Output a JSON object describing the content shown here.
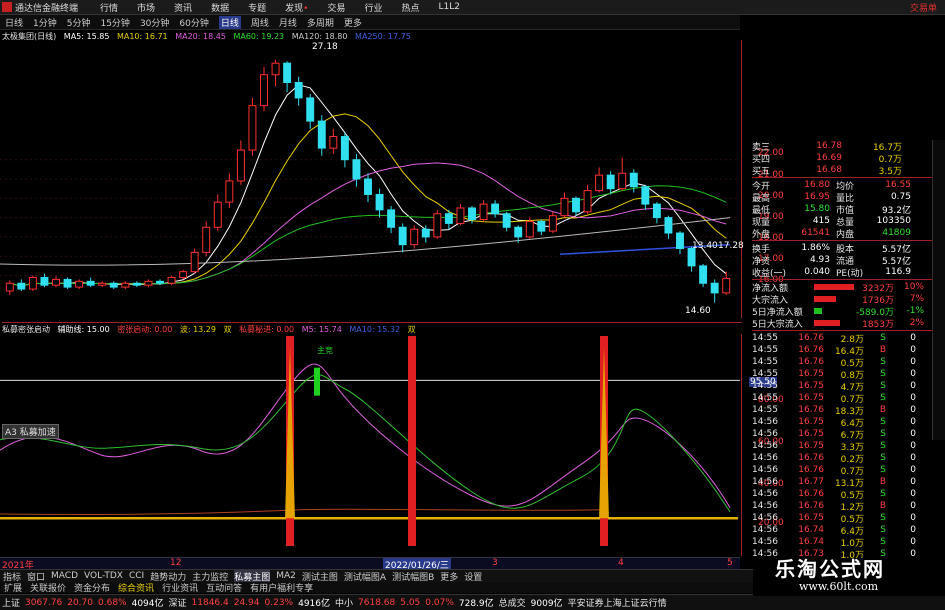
{
  "app": {
    "title": "通达信金融终端",
    "menu": [
      "行情",
      "市场",
      "资讯",
      "数据",
      "专题",
      "发现",
      "交易",
      "行业",
      "热点",
      "L1L2"
    ],
    "top_right": "交易单"
  },
  "periods": [
    "日线",
    "1分钟",
    "5分钟",
    "15分钟",
    "30分钟",
    "60分钟",
    "日线",
    "周线",
    "月线",
    "多周期",
    "更多"
  ],
  "main_legend": {
    "name": "太极集团(日线)",
    "ma5": "MA5: 15.85",
    "ma10": "MA10: 16.71",
    "ma20": "MA20: 18.45",
    "ma60": "MA60: 19.23",
    "ma120": "MA120: 18.80",
    "ma250": "MA250: 17.75"
  },
  "annotations": {
    "high": "27.18",
    "low": "14.60",
    "mid": "13.40",
    "right_mark": "17.28"
  },
  "price_axis": [
    "22.00",
    "21.00",
    "20.00",
    "19.00",
    "18.00",
    "17.00",
    "16.00",
    "15.00"
  ],
  "ind_legend": {
    "name": "私募密张启动",
    "a": "辅助线: 15.00",
    "b": "密张启动: 0.00",
    "c": "波: 13.29",
    "d": "私募秘进: 0.00",
    "e": "M5: 15.74",
    "f": "MA10: 15.32"
  },
  "ind_axis": [
    "95.50",
    "80.00",
    "60.00",
    "40.00",
    "20.00"
  ],
  "markers": {
    "m1": "双",
    "m2": "双",
    "green": "主竞"
  },
  "overlay_label": "A3 私募加速",
  "time_axis": {
    "left": "2021年",
    "mid1": "12",
    "cursor": "2022/01/26/三",
    "mid2": "3",
    "mid3": "4",
    "mid4": "5"
  },
  "quote": {
    "sell": [
      [
        "卖三",
        "16.78",
        "16.7万"
      ],
      [
        "买四",
        "16.69",
        "0.7万"
      ],
      [
        "买五",
        "16.68",
        "3.5万"
      ]
    ],
    "stats": [
      [
        "今开",
        "16.80",
        "均价",
        "16.55"
      ],
      [
        "最高",
        "16.95",
        "量比",
        "0.75"
      ],
      [
        "最低",
        "15.80",
        "市值",
        "93.2亿"
      ],
      [
        "现量",
        "415",
        "总量",
        "103350"
      ],
      [
        "外盘",
        "61541",
        "内盘",
        "41809"
      ],
      [
        "换手",
        "1.86%",
        "股本",
        "5.57亿"
      ],
      [
        "净资",
        "4.93",
        "流通",
        "5.57亿"
      ],
      [
        "收益(一)",
        "0.040",
        "PE(动)",
        "116.9"
      ]
    ],
    "flows": [
      [
        "净流入额",
        "3232万",
        "10%"
      ],
      [
        "大宗流入",
        "1736万",
        "7%"
      ],
      [
        "5日净流入额",
        "-589.0万",
        "-1%"
      ],
      [
        "5日大宗流入",
        "1853万",
        "2%"
      ]
    ],
    "ticks": [
      [
        "14:55",
        "16.76",
        "2.8万",
        "S",
        "0"
      ],
      [
        "14:55",
        "16.76",
        "16.4万",
        "B",
        "0"
      ],
      [
        "14:55",
        "16.76",
        "0.5万",
        "S",
        "0"
      ],
      [
        "14:55",
        "16.75",
        "0.8万",
        "S",
        "0"
      ],
      [
        "14:55",
        "16.75",
        "4.7万",
        "S",
        "0"
      ],
      [
        "14:55",
        "16.75",
        "0.7万",
        "S",
        "0"
      ],
      [
        "14:55",
        "16.76",
        "18.3万",
        "B",
        "0"
      ],
      [
        "14:56",
        "16.75",
        "6.4万",
        "S",
        "0"
      ],
      [
        "14:56",
        "16.75",
        "6.7万",
        "S",
        "0"
      ],
      [
        "14:56",
        "16.75",
        "3.3万",
        "S",
        "0"
      ],
      [
        "14:56",
        "16.76",
        "0.2万",
        "S",
        "0"
      ],
      [
        "14:56",
        "16.76",
        "0.7万",
        "S",
        "0"
      ],
      [
        "14:56",
        "16.77",
        "13.1万",
        "B",
        "0"
      ],
      [
        "14:56",
        "16.76",
        "0.5万",
        "S",
        "0"
      ],
      [
        "14:56",
        "16.76",
        "1.2万",
        "B",
        "0"
      ],
      [
        "14:56",
        "16.75",
        "0.5万",
        "S",
        "0"
      ],
      [
        "14:56",
        "16.74",
        "6.4万",
        "S",
        "0"
      ],
      [
        "14:56",
        "16.74",
        "1.0万",
        "S",
        "0"
      ],
      [
        "14:56",
        "16.73",
        "1.0万",
        "S",
        "0"
      ]
    ]
  },
  "tabs": [
    "指标",
    "窗口",
    "MACD",
    "VOL-TDX",
    "CCI",
    "趋势动力",
    "主力监控",
    "私募主图",
    "MA2",
    "测试主图",
    "测试幅图A",
    "测试幅图B",
    "更多",
    "设置"
  ],
  "tabs2": [
    "扩展",
    "关联报价",
    "资金分布",
    "综合资讯",
    "行业资讯",
    "互动问答",
    "有用户福利专享"
  ],
  "tab_right": "模板",
  "status": {
    "sh_label": "上证",
    "sh_val": "3067.76",
    "sh_chg": "20.70",
    "sh_pct": "0.68%",
    "sh_amt": "4094亿",
    "sz_label": "深证",
    "sz_val": "11846.4",
    "sz_chg": "24.94",
    "sz_pct": "0.23%",
    "sz_amt": "4916亿",
    "zx_label": "中小",
    "zx_val": "7618.68",
    "zx_chg": "5.05",
    "zx_pct": "0.07%",
    "zx_amt": "728.9亿",
    "total_label": "总成交",
    "total_val": "9009亿",
    "broker": "平安证券上海上证云行情"
  },
  "watermark": {
    "title": "乐淘公式网",
    "url": "www.60lt.com"
  },
  "chart_data": {
    "type": "candlestick",
    "candles": [
      [
        15.2,
        15.6,
        15.0,
        15.75
      ],
      [
        15.6,
        15.3,
        15.2,
        15.8
      ],
      [
        15.3,
        15.9,
        15.2,
        16.0
      ],
      [
        15.9,
        15.5,
        15.4,
        16.1
      ],
      [
        15.5,
        15.8,
        15.4,
        15.95
      ],
      [
        15.8,
        15.4,
        15.3,
        15.9
      ],
      [
        15.4,
        15.7,
        15.3,
        15.8
      ],
      [
        15.7,
        15.5,
        15.4,
        15.9
      ],
      [
        15.5,
        15.6,
        15.4,
        15.7
      ],
      [
        15.6,
        15.4,
        15.3,
        15.7
      ],
      [
        15.4,
        15.6,
        15.3,
        15.7
      ],
      [
        15.6,
        15.5,
        15.4,
        15.7
      ],
      [
        15.5,
        15.7,
        15.4,
        15.8
      ],
      [
        15.7,
        15.6,
        15.5,
        15.8
      ],
      [
        15.6,
        15.9,
        15.5,
        16.0
      ],
      [
        15.9,
        16.2,
        15.8,
        16.3
      ],
      [
        16.2,
        17.2,
        16.1,
        17.4
      ],
      [
        17.2,
        18.5,
        17.0,
        18.8
      ],
      [
        18.5,
        19.8,
        18.3,
        20.2
      ],
      [
        19.8,
        20.9,
        19.5,
        21.3
      ],
      [
        20.9,
        22.5,
        20.7,
        23.0
      ],
      [
        22.5,
        24.8,
        22.2,
        25.2
      ],
      [
        24.8,
        26.4,
        24.5,
        26.8
      ],
      [
        26.4,
        27.0,
        25.8,
        27.18
      ],
      [
        27.0,
        26.0,
        25.5,
        27.1
      ],
      [
        26.0,
        25.2,
        24.8,
        26.3
      ],
      [
        25.2,
        24.0,
        23.6,
        25.4
      ],
      [
        24.0,
        22.6,
        22.2,
        24.3
      ],
      [
        22.6,
        23.2,
        22.3,
        23.6
      ],
      [
        23.2,
        22.0,
        21.6,
        23.4
      ],
      [
        22.0,
        21.0,
        20.6,
        22.3
      ],
      [
        21.0,
        20.2,
        19.8,
        21.3
      ],
      [
        20.2,
        19.4,
        19.0,
        20.5
      ],
      [
        19.4,
        18.5,
        18.2,
        19.6
      ],
      [
        18.5,
        17.6,
        17.2,
        18.7
      ],
      [
        17.6,
        18.4,
        17.4,
        18.6
      ],
      [
        18.4,
        18.0,
        17.7,
        18.6
      ],
      [
        18.0,
        19.2,
        17.9,
        19.4
      ],
      [
        19.2,
        18.7,
        18.4,
        19.4
      ],
      [
        18.7,
        19.5,
        18.6,
        19.7
      ],
      [
        19.5,
        18.9,
        18.7,
        19.6
      ],
      [
        18.9,
        19.7,
        18.8,
        19.9
      ],
      [
        19.7,
        19.2,
        19.0,
        19.9
      ],
      [
        19.2,
        18.5,
        18.3,
        19.3
      ],
      [
        18.5,
        18.0,
        17.7,
        18.6
      ],
      [
        18.0,
        18.8,
        17.9,
        19.0
      ],
      [
        18.8,
        18.3,
        18.1,
        18.9
      ],
      [
        18.3,
        19.1,
        18.2,
        19.3
      ],
      [
        19.1,
        20.0,
        19.0,
        20.3
      ],
      [
        20.0,
        19.3,
        19.1,
        20.1
      ],
      [
        19.3,
        20.4,
        19.2,
        20.7
      ],
      [
        20.4,
        21.2,
        20.3,
        21.6
      ],
      [
        21.2,
        20.5,
        20.2,
        21.4
      ],
      [
        20.5,
        21.3,
        20.4,
        22.1
      ],
      [
        21.3,
        20.6,
        20.3,
        21.5
      ],
      [
        20.6,
        19.7,
        19.4,
        20.7
      ],
      [
        19.7,
        19.0,
        18.7,
        19.8
      ],
      [
        19.0,
        18.2,
        17.9,
        19.1
      ],
      [
        18.2,
        17.4,
        17.1,
        18.3
      ],
      [
        17.4,
        16.5,
        16.2,
        17.5
      ],
      [
        16.5,
        15.6,
        15.4,
        16.6
      ],
      [
        15.6,
        15.1,
        14.6,
        15.8
      ],
      [
        15.1,
        15.85,
        15.0,
        16.2
      ]
    ]
  }
}
